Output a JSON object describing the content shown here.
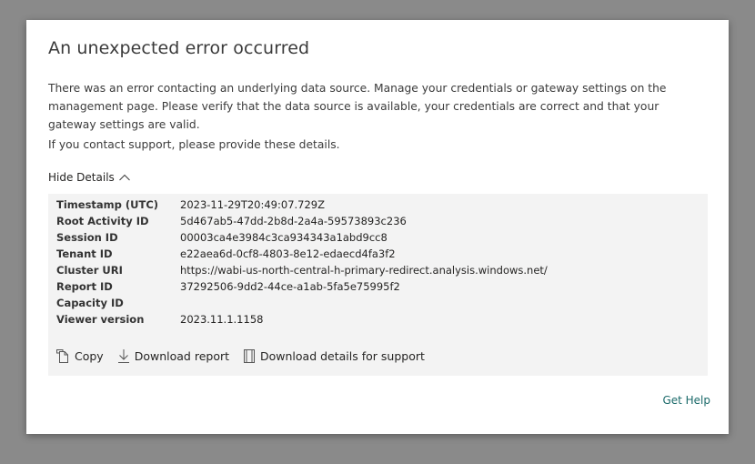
{
  "dialog": {
    "title": "An unexpected error occurred",
    "message": "There was an error contacting an underlying data source. Manage your credentials or gateway settings on the management page. Please verify that the data source is available, your credentials are correct and that your gateway settings are valid.",
    "support_text": "If you contact support, please provide these details.",
    "toggle_label": "Hide Details",
    "toggle_icon": "chevron-up-icon",
    "details": [
      {
        "key": "Timestamp (UTC)",
        "value": "2023-11-29T20:49:07.729Z"
      },
      {
        "key": "Root Activity ID",
        "value": "5d467ab5-47dd-2b8d-2a4a-59573893c236"
      },
      {
        "key": "Session ID",
        "value": "00003ca4e3984c3ca934343a1abd9cc8"
      },
      {
        "key": "Tenant ID",
        "value": "e22aea6d-0cf8-4803-8e12-edaecd4fa3f2"
      },
      {
        "key": "Cluster URI",
        "value": "https://wabi-us-north-central-h-primary-redirect.analysis.windows.net/"
      },
      {
        "key": "Report ID",
        "value": "37292506-9dd2-44ce-a1ab-5fa5e75995f2"
      },
      {
        "key": "Capacity ID",
        "value": ""
      },
      {
        "key": "Viewer version",
        "value": "2023.11.1.1158"
      }
    ],
    "actions": {
      "copy": {
        "label": "Copy",
        "icon": "copy-icon"
      },
      "download_report": {
        "label": "Download report",
        "icon": "download-icon"
      },
      "download_details": {
        "label": "Download details for support",
        "icon": "document-icon"
      }
    },
    "get_help": "Get Help"
  },
  "colors": {
    "overlay": "#8a8a8a",
    "dialog_bg": "#ffffff",
    "details_bg": "#f3f3f3",
    "text": "#3b3b3b",
    "link": "#1b6a6a"
  }
}
